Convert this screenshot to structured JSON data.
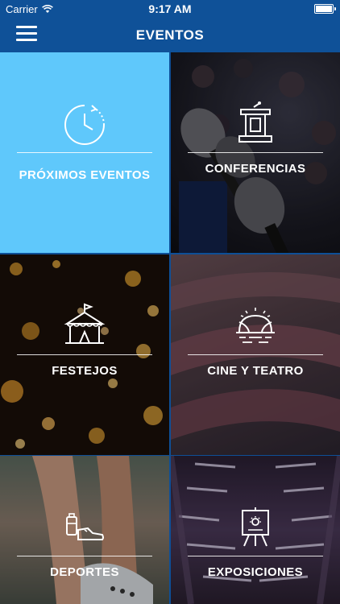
{
  "status_bar": {
    "carrier": "Carrier",
    "time": "9:17 AM"
  },
  "navbar": {
    "title": "EVENTOS",
    "menu_icon": "hamburger-menu-icon"
  },
  "tiles": [
    {
      "label": "PRÓXIMOS EVENTOS",
      "icon": "clock-icon",
      "color": "#5fc8fb"
    },
    {
      "label": "CONFERENCIAS",
      "icon": "podium-icon"
    },
    {
      "label": "FESTEJOS",
      "icon": "circus-tent-icon"
    },
    {
      "label": "CINE Y TEATRO",
      "icon": "theater-stage-icon"
    },
    {
      "label": "DEPORTES",
      "icon": "sports-shoe-bottle-icon"
    },
    {
      "label": "EXPOSICIONES",
      "icon": "easel-icon"
    }
  ],
  "colors": {
    "navbar": "#0f5198",
    "accent_tile": "#5fc8fb"
  }
}
